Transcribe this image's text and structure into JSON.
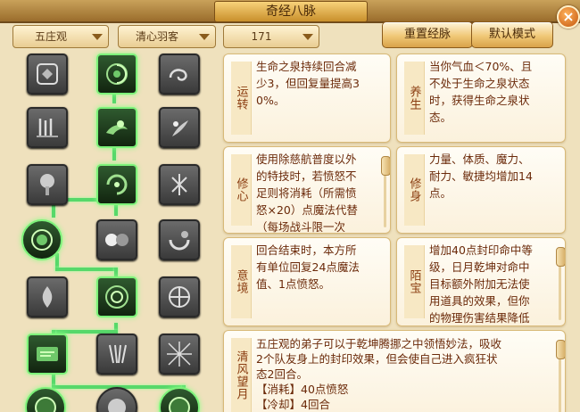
{
  "window": {
    "title": "奇经八脉",
    "close_icon": "close-icon"
  },
  "toolbar": {
    "faction": {
      "value": "五庄观"
    },
    "school": {
      "value": "清心羽客"
    },
    "level": {
      "value": "171"
    },
    "reset_label": "重置经脉",
    "default_label": "默认模式"
  },
  "colors": {
    "accent": "#d9a24a",
    "text_dark": "#6b2a0a",
    "lit_glow": "#7df27a",
    "panel_bg": "#efe1bd"
  },
  "skill_tree": {
    "nodes": [
      {
        "icon": "curse-seal-icon",
        "lit": false
      },
      {
        "icon": "wind-swirl-icon",
        "lit": true
      },
      {
        "icon": "cloud-spiral-icon",
        "lit": false
      },
      {
        "icon": "waterfall-icon",
        "lit": false
      },
      {
        "icon": "dragon-cloud-icon",
        "lit": true
      },
      {
        "icon": "lotus-spirit-icon",
        "lit": false
      },
      {
        "icon": "tree-icon",
        "lit": false
      },
      {
        "icon": "swirl-aura-icon",
        "lit": true
      },
      {
        "icon": "feather-icon",
        "lit": false
      },
      {
        "icon": "spiral-orb-icon",
        "lit": true
      },
      {
        "icon": "twin-orbs-icon",
        "lit": false
      },
      {
        "icon": "swirl-moon-icon",
        "lit": false
      },
      {
        "icon": "flame-bottle-icon",
        "lit": false
      },
      {
        "icon": "rune-disc-icon",
        "lit": true
      },
      {
        "icon": "target-circle-icon",
        "lit": false
      },
      {
        "icon": "scroll-tablet-icon",
        "lit": true
      },
      {
        "icon": "claw-icon",
        "lit": false
      },
      {
        "icon": "net-web-icon",
        "lit": false
      },
      {
        "icon": "jade-ring-icon",
        "lit": true
      },
      {
        "icon": "spirit-orb-icon",
        "lit": false
      },
      {
        "icon": "jade-ring-icon",
        "lit": true
      }
    ]
  },
  "cards": [
    {
      "tag": "运转",
      "lines": [
        "生命之泉持续回合减",
        "少3，但回复量提高3",
        "0%。"
      ]
    },
    {
      "tag": "养生",
      "lines": [
        "当你气血＜70%、且",
        "不处于生命之泉状态",
        "时，获得生命之泉状",
        "态。"
      ]
    },
    {
      "tag": "修心",
      "lines": [
        "使用除慈航普度以外",
        "的特技时，若愤怒不",
        "足则将消耗（所需愤",
        "怒×20）点魔法代替",
        "（每场战斗限一次"
      ]
    },
    {
      "tag": "修身",
      "lines": [
        "力量、体质、魔力、",
        "耐力、敏捷均增加14",
        "点。"
      ]
    },
    {
      "tag": "意境",
      "lines": [
        "回合结束时，本方所",
        "有单位回复24点魔法",
        "值、1点愤怒。"
      ]
    },
    {
      "tag": "陌宝",
      "lines": [
        "增加40点封印命中等",
        "级，日月乾坤对命中",
        "目标额外附加无法使",
        "用道具的效果，但你",
        "的物理伤害结果降低"
      ]
    }
  ],
  "bottom_card": {
    "tag": "清风望月",
    "lines": [
      "五庄观的弟子可以于乾坤腾挪之中领悟妙法，吸收",
      "2个队友身上的封印效果，但会使自己进入疯狂状",
      "态2回合。",
      "【消耗】40点愤怒",
      "【冷却】4回合"
    ]
  }
}
